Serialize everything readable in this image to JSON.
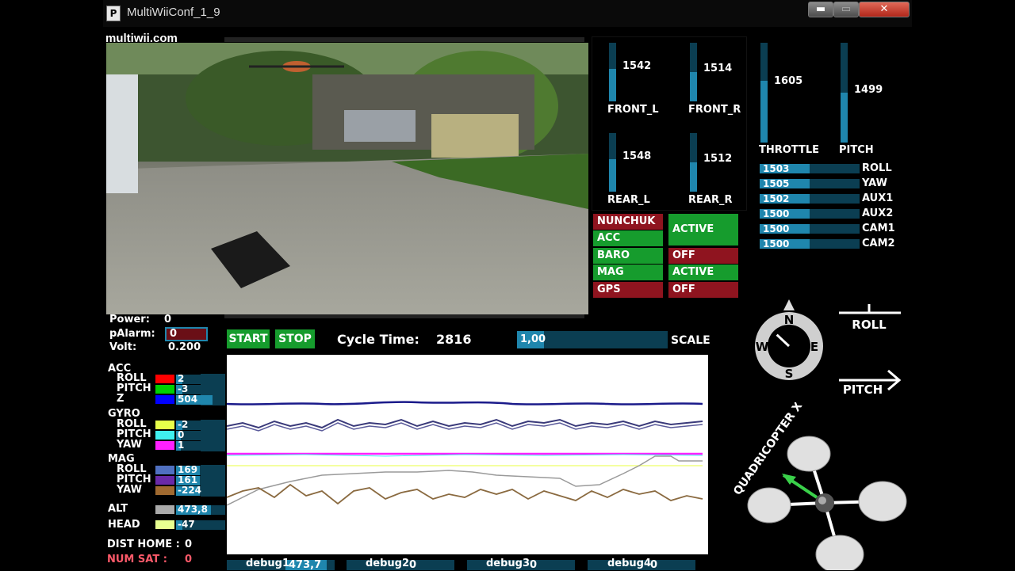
{
  "window": {
    "title": "MultiWiiConf_1_9",
    "icon_letter": "P",
    "min": "▬",
    "max": "▭",
    "close": "✕"
  },
  "site": "multiwii.com",
  "motors": [
    {
      "label": "FRONT_L",
      "value": "1542",
      "level": 0.55
    },
    {
      "label": "FRONT_R",
      "value": "1514",
      "level": 0.5
    },
    {
      "label": "REAR_L",
      "value": "1548",
      "level": 0.56
    },
    {
      "label": "REAR_R",
      "value": "1512",
      "level": 0.5
    }
  ],
  "rc": {
    "throttle": {
      "label": "THROTTLE",
      "value": "1605",
      "level": 0.62
    },
    "pitch": {
      "label": "PITCH",
      "value": "1499",
      "level": 0.5
    },
    "channels": [
      {
        "label": "ROLL",
        "value": "1503",
        "level": 0.5
      },
      {
        "label": "YAW",
        "value": "1505",
        "level": 0.5
      },
      {
        "label": "AUX1",
        "value": "1502",
        "level": 0.5
      },
      {
        "label": "AUX2",
        "value": "1500",
        "level": 0.5
      },
      {
        "label": "CAM1",
        "value": "1500",
        "level": 0.5
      },
      {
        "label": "CAM2",
        "value": "1500",
        "level": 0.5
      }
    ]
  },
  "sensors": {
    "nunchuk": "NUNCHUK",
    "acc": "ACC",
    "baro": "BARO",
    "mag": "MAG",
    "gps": "GPS",
    "acc_state": "ACTIVE",
    "baro_state": "OFF",
    "mag_state": "ACTIVE",
    "gps_state": "OFF"
  },
  "status": {
    "power_label": "Power:",
    "power_value": "0",
    "palarm_label": "pAlarm:",
    "palarm_value": "0",
    "volt_label": "Volt:",
    "volt_value": "0.200"
  },
  "controls": {
    "start": "START",
    "stop": "STOP",
    "cycle_label": "Cycle Time:",
    "cycle_value": "2816",
    "scale_value": "1,00",
    "scale_label": "SCALE"
  },
  "acc": {
    "title": "ACC",
    "roll_label": "ROLL",
    "pitch_label": "PITCH",
    "z_label": "Z",
    "roll": "2",
    "pitch": "-3",
    "z": "504"
  },
  "gyro": {
    "title": "GYRO",
    "roll_label": "ROLL",
    "pitch_label": "PITCH",
    "yaw_label": "YAW",
    "roll": "-2",
    "pitch": "0",
    "yaw": "1"
  },
  "mag": {
    "title": "MAG",
    "roll_label": "ROLL",
    "pitch_label": "PITCH",
    "yaw_label": "YAW",
    "roll": "169",
    "pitch": "161",
    "yaw": "-224"
  },
  "alt": {
    "label": "ALT",
    "value": "473,8"
  },
  "head": {
    "label": "HEAD",
    "value": "-47"
  },
  "dist_home": {
    "label": "DIST HOME :",
    "value": "0"
  },
  "num_sat": {
    "label": "NUM SAT   :",
    "value": "0"
  },
  "debug": [
    {
      "label": "debug1",
      "value": "473,7"
    },
    {
      "label": "debug2",
      "value": "0"
    },
    {
      "label": "debug3",
      "value": "0"
    },
    {
      "label": "debug4",
      "value": "0"
    }
  ],
  "compass": {
    "n": "N",
    "s": "S",
    "e": "E",
    "w": "W",
    "heading_deg": -47
  },
  "attitude": {
    "roll_label": "ROLL",
    "pitch_label": "PITCH"
  },
  "frame": {
    "label": "QUADRICOPTER X"
  },
  "colors": {
    "bar_bg": "#0b3e52",
    "bar_fill": "#1f86ad",
    "green": "#169c2d",
    "red": "#8f141f",
    "acc_roll": "#ff0000",
    "acc_pitch": "#00d000",
    "acc_z": "#0000ff",
    "gyro_roll": "#e8ff4a",
    "gyro_pitch": "#40f0f0",
    "gyro_yaw": "#ff20ff",
    "mag_roll": "#5070c0",
    "mag_pitch": "#6a2aa8",
    "mag_yaw": "#a06a30",
    "alt": "#aaaaaa",
    "head": "#e8ff90"
  }
}
